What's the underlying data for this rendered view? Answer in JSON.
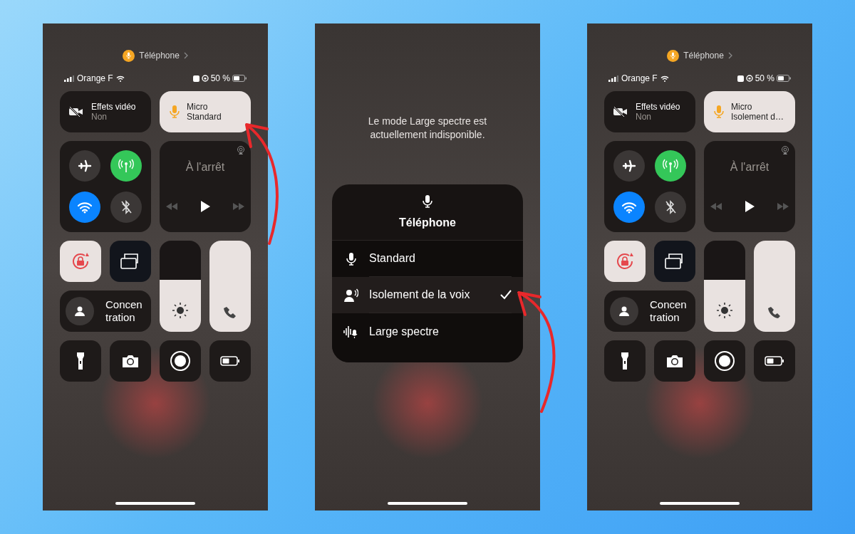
{
  "phones": [
    {
      "kind": "control_center",
      "app_label": "Téléphone",
      "carrier": "Orange F",
      "battery_percent": "50 %",
      "video_effects": {
        "title": "Effets vidéo",
        "value": "Non"
      },
      "mic": {
        "title": "Micro",
        "value": "Standard"
      },
      "now_playing": "À l'arrêt",
      "toggles": [
        {
          "kind": "airplane",
          "on": false
        },
        {
          "kind": "cellular",
          "on": true
        },
        {
          "kind": "wifi",
          "on": true
        },
        {
          "kind": "bluetooth",
          "on": false
        }
      ],
      "orientation_lock": true,
      "focus_lines": [
        "Concen",
        "tration"
      ],
      "brightness": {
        "level": 0.57
      },
      "volume": {
        "level": 1
      }
    },
    {
      "kind": "mic_menu",
      "notice": "Le mode Large spectre est actuellement indisponible.",
      "menu_title": "Téléphone",
      "options": [
        {
          "kind": "standard",
          "label": "Standard",
          "selected": false
        },
        {
          "kind": "voice_isolation",
          "label": "Isolement de la voix",
          "selected": true
        },
        {
          "kind": "wide_spectrum",
          "label": "Large spectre",
          "selected": false
        }
      ]
    },
    {
      "kind": "control_center",
      "app_label": "Téléphone",
      "carrier": "Orange F",
      "battery_percent": "50 %",
      "video_effects": {
        "title": "Effets vidéo",
        "value": "Non"
      },
      "mic": {
        "title": "Micro",
        "value": "Isolement d…"
      },
      "now_playing": "À l'arrêt",
      "toggles": [
        {
          "kind": "airplane",
          "on": false
        },
        {
          "kind": "cellular",
          "on": true
        },
        {
          "kind": "wifi",
          "on": true
        },
        {
          "kind": "bluetooth",
          "on": false
        }
      ],
      "orientation_lock": true,
      "focus_lines": [
        "Concen",
        "tration"
      ],
      "brightness": {
        "level": 0.57
      },
      "volume": {
        "level": 1
      }
    }
  ]
}
